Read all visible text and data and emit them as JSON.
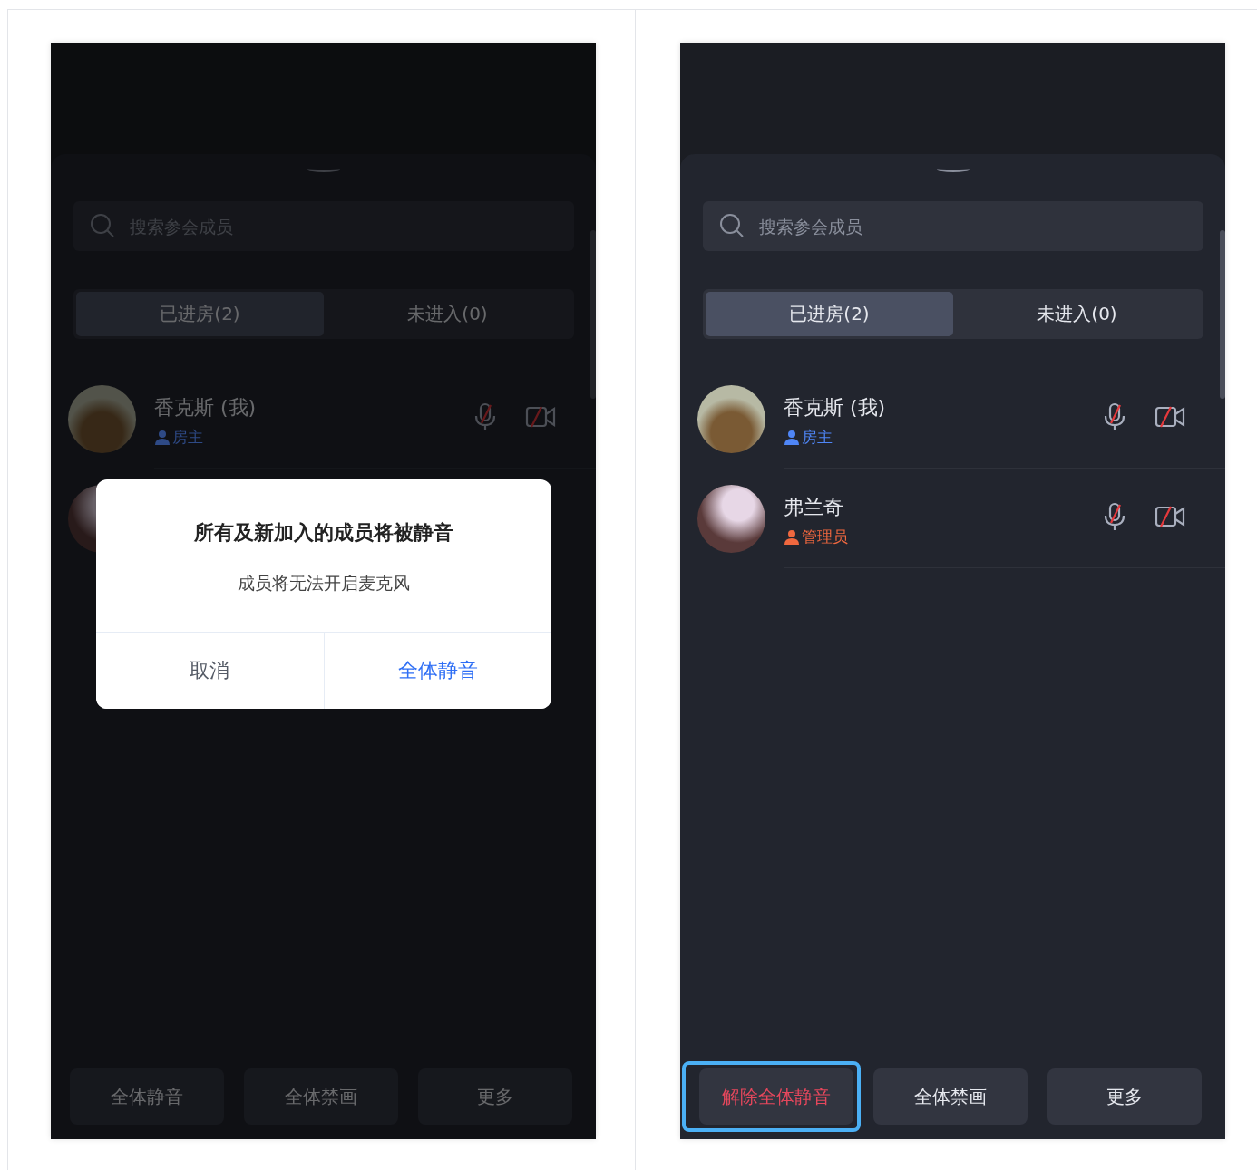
{
  "panels": [
    {
      "search": {
        "placeholder": "搜索参会成员"
      },
      "tabs": [
        {
          "label": "已进房(2)",
          "selected": true
        },
        {
          "label": "未进入(0)",
          "selected": false
        }
      ],
      "members": [
        {
          "kind": "row",
          "name": "香克斯 (我)",
          "role": "房主",
          "color": "#2e4a86",
          "mic_muted": true,
          "camera_off": true
        },
        {
          "kind": "covered"
        }
      ],
      "buttons": [
        {
          "label": "全体静音",
          "kind": "normal",
          "highlighted": false
        },
        {
          "label": "全体禁画",
          "kind": "normal",
          "highlighted": false
        },
        {
          "label": "更多",
          "kind": "normal",
          "highlighted": false
        }
      ],
      "dialog": {
        "title": "所有及新加入的成员将被静音",
        "message": "成员将无法开启麦克风",
        "actions": [
          {
            "label": "取消",
            "kind": "cancel"
          },
          {
            "label": "全体静音",
            "kind": "confirm"
          }
        ]
      }
    },
    {
      "search": {
        "placeholder": "搜索参会成员"
      },
      "tabs": [
        {
          "label": "已进房(2)",
          "selected": true
        },
        {
          "label": "未进入(0)",
          "selected": false
        }
      ],
      "members": [
        {
          "kind": "row",
          "name": "香克斯 (我)",
          "role": "房主",
          "color": "#4f86f7",
          "mic_muted": true,
          "camera_off": true
        },
        {
          "kind": "row",
          "name": "弗兰奇",
          "role": "管理员",
          "color": "#f0683f",
          "mic_muted": true,
          "camera_off": true
        }
      ],
      "buttons": [
        {
          "label": "解除全体静音",
          "kind": "danger",
          "highlighted": true
        },
        {
          "label": "全体禁画",
          "kind": "normal",
          "highlighted": false
        },
        {
          "label": "更多",
          "kind": "normal",
          "highlighted": false
        }
      ]
    }
  ]
}
